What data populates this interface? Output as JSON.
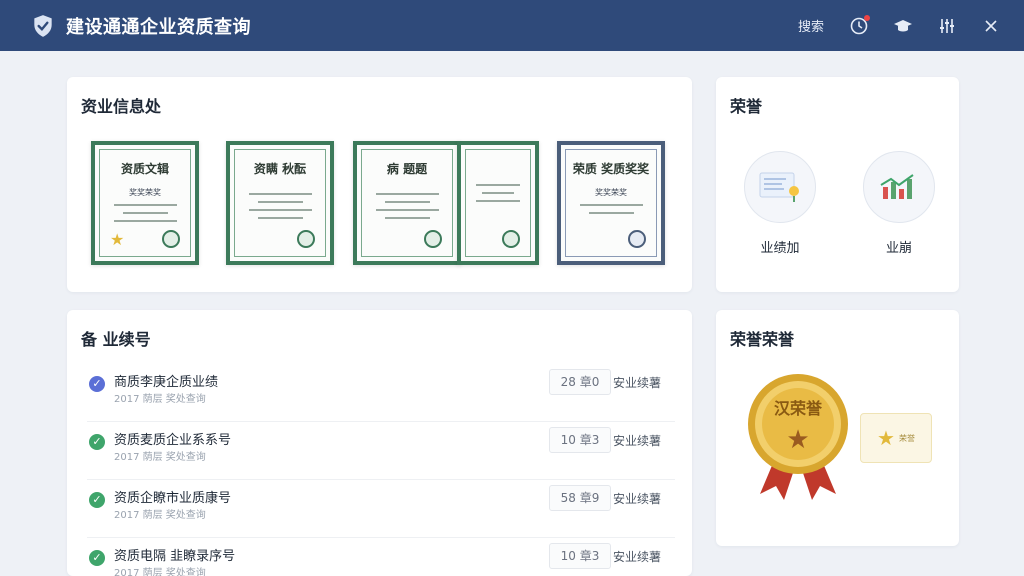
{
  "app": {
    "title": "建设通通企业资质查询"
  },
  "toolbar": {
    "search_label": "搜索"
  },
  "qualification": {
    "title": "资业信息处",
    "certs": [
      {
        "title": "资质文辑",
        "sub": "奖奖荣奖"
      },
      {
        "title": "资瞒 秋酝",
        "sub": ""
      },
      {
        "title": "病 题题",
        "sub": ""
      },
      {
        "title": "",
        "sub": ""
      },
      {
        "title": "荣质 奖质奖奖",
        "sub": "奖奖荣奖"
      }
    ]
  },
  "honors_top": {
    "title": "荣誉",
    "items": [
      {
        "label": "业绩加"
      },
      {
        "label": "业崩"
      }
    ]
  },
  "performance": {
    "title": "备  业续号",
    "rows": [
      {
        "title": "商质李庚企质业绩",
        "sub": "2017 荫层 奖处查询",
        "count": "28 章0",
        "tag": "安业续薯"
      },
      {
        "title": "资质麦质企业系系号",
        "sub": "2017 荫层 奖处查询",
        "count": "10 章3",
        "tag": "安业续薯"
      },
      {
        "title": "资质企瞭市业质康号",
        "sub": "2017 荫层 奖处查询",
        "count": "58 章9",
        "tag": "安业续薯"
      },
      {
        "title": "资质电隔  韭瞭录序号",
        "sub": "2017 荫层 奖处查询",
        "count": "10 章3",
        "tag": "安业续薯"
      }
    ]
  },
  "honors_bottom": {
    "title": "荣誉荣誉",
    "medal_text": "汉荣誉",
    "badge_text": "荣誉"
  },
  "colors": {
    "titlebar": "#2f4a7a",
    "accent_green": "#3fa56b",
    "accent_blue": "#5b6fd6",
    "gold": "#e2b93b"
  }
}
